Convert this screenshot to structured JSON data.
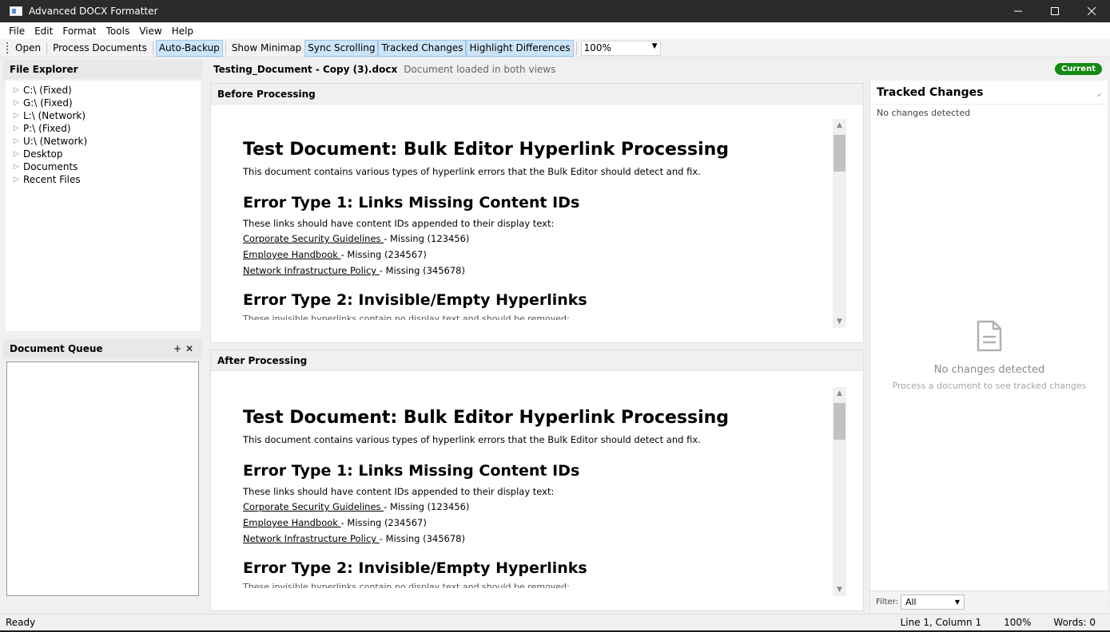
{
  "window": {
    "title": "Advanced DOCX Formatter"
  },
  "menu": [
    "File",
    "Edit",
    "Format",
    "Tools",
    "View",
    "Help"
  ],
  "toolbar": {
    "open_label": "Open",
    "process_label": "Process Documents",
    "auto_backup_label": "Auto-Backup",
    "show_minimap_label": "Show Minimap",
    "sync_scrolling_label": "Sync Scrolling",
    "tracked_changes_label": "Tracked Changes",
    "highlight_diff_label": "Highlight Differences",
    "zoom_value": "100%"
  },
  "file_explorer": {
    "title": "File Explorer",
    "items": [
      "C:\\ (Fixed)",
      "G:\\ (Fixed)",
      "L:\\ (Network)",
      "P:\\ (Fixed)",
      "U:\\ (Network)",
      "Desktop",
      "Documents",
      "Recent Files"
    ]
  },
  "document_queue": {
    "title": "Document Queue",
    "add_glyph": "+",
    "close_glyph": "✕"
  },
  "document": {
    "name": "Testing_Document - Copy (3).docx",
    "status": "Document loaded in both views",
    "badge": "Current"
  },
  "panes": {
    "before_title": "Before Processing",
    "after_title": "After Processing"
  },
  "doc_content": {
    "h1": "Test Document: Bulk Editor Hyperlink Processing",
    "intro": "This document contains various types of hyperlink errors that the Bulk Editor should detect and fix.",
    "h2a": "Error Type 1: Links Missing Content IDs",
    "p2": "These links should have content IDs appended to their display text:",
    "link1": "Corporate Security Guidelines ",
    "link1_suffix": " - Missing (123456)",
    "link2": "Employee Handbook ",
    "link2_suffix": " - Missing (234567)",
    "link3": "Network Infrastructure Policy ",
    "link3_suffix": " - Missing (345678)",
    "h2b": "Error Type 2: Invisible/Empty Hyperlinks",
    "cut_line": "These invisible hyperlinks contain no display text and should be removed:"
  },
  "tracked_changes": {
    "title": "Tracked Changes",
    "subtitle": "No changes detected",
    "empty_title": "No changes detected",
    "empty_hint": "Process a document to see tracked changes",
    "filter_label": "Filter:",
    "filter_value": "All"
  },
  "status": {
    "ready": "Ready",
    "position": "Line 1, Column 1",
    "zoom": "100%",
    "words": "Words: 0"
  },
  "colors": {
    "badge": "#148a14",
    "toggle_active": "#cce4f7",
    "titlebar": "#2b2b2b"
  }
}
